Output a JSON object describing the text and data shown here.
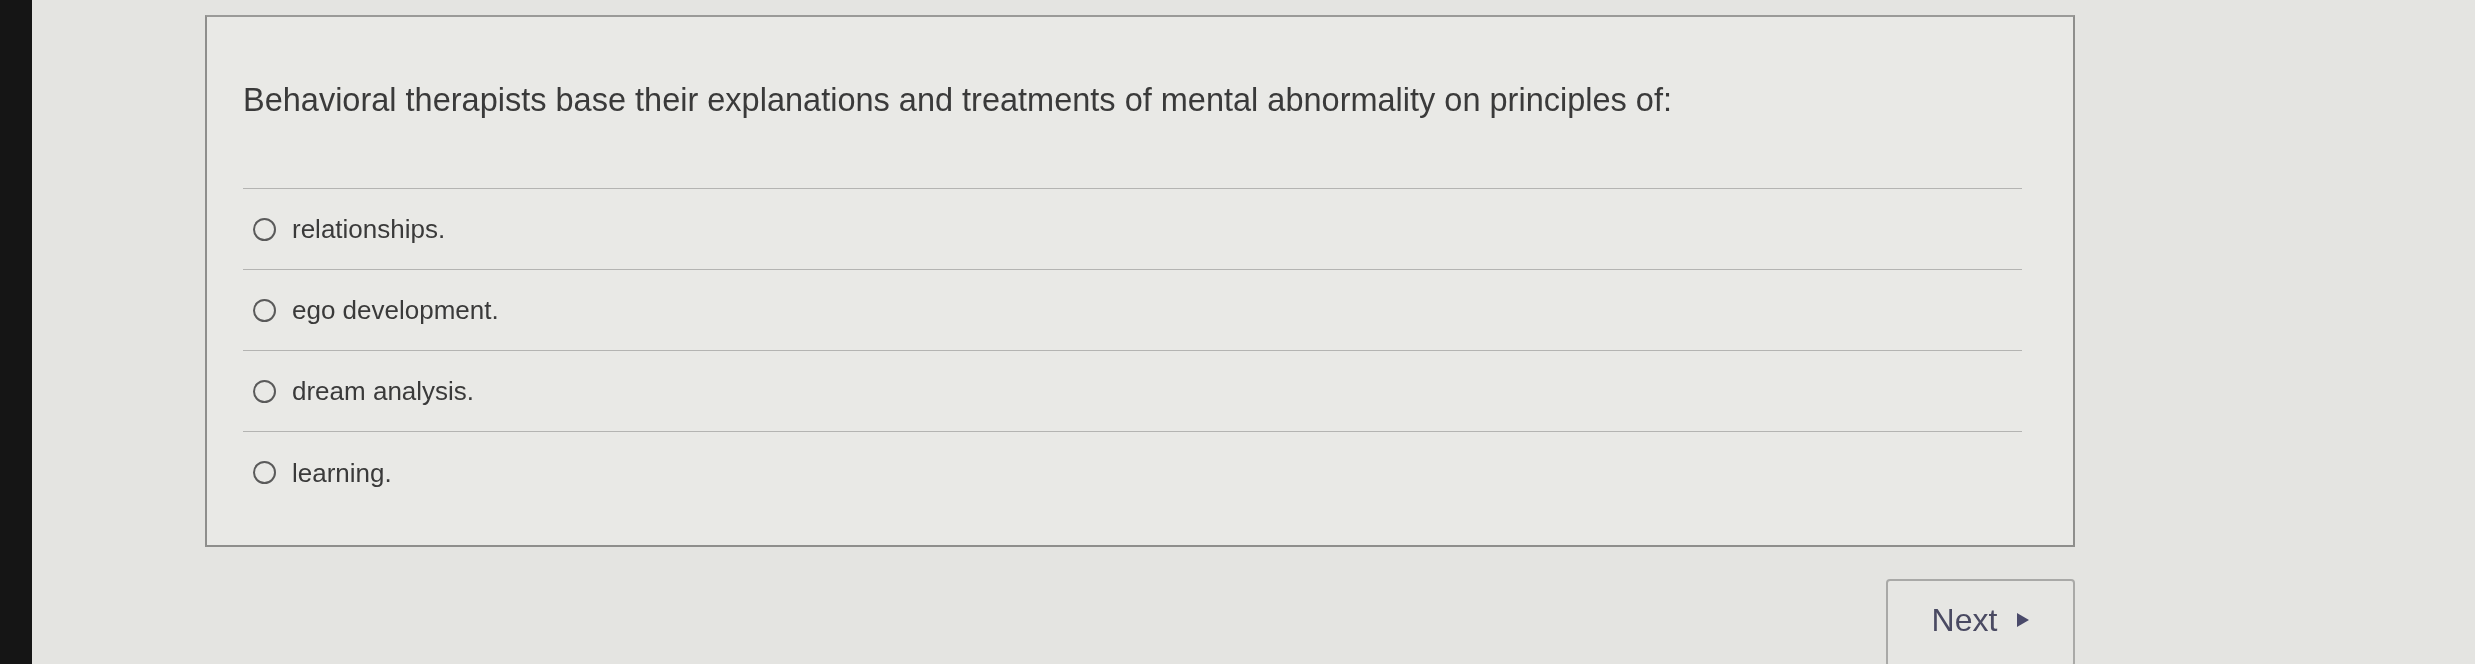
{
  "question": {
    "text": "Behavioral therapists base their explanations and treatments of mental abnormality on principles of:"
  },
  "options": [
    {
      "label": "relationships.",
      "selected": false
    },
    {
      "label": "ego development.",
      "selected": false
    },
    {
      "label": "dream analysis.",
      "selected": false
    },
    {
      "label": "learning.",
      "selected": false
    }
  ],
  "buttons": [
    {
      "label": "Next"
    }
  ]
}
